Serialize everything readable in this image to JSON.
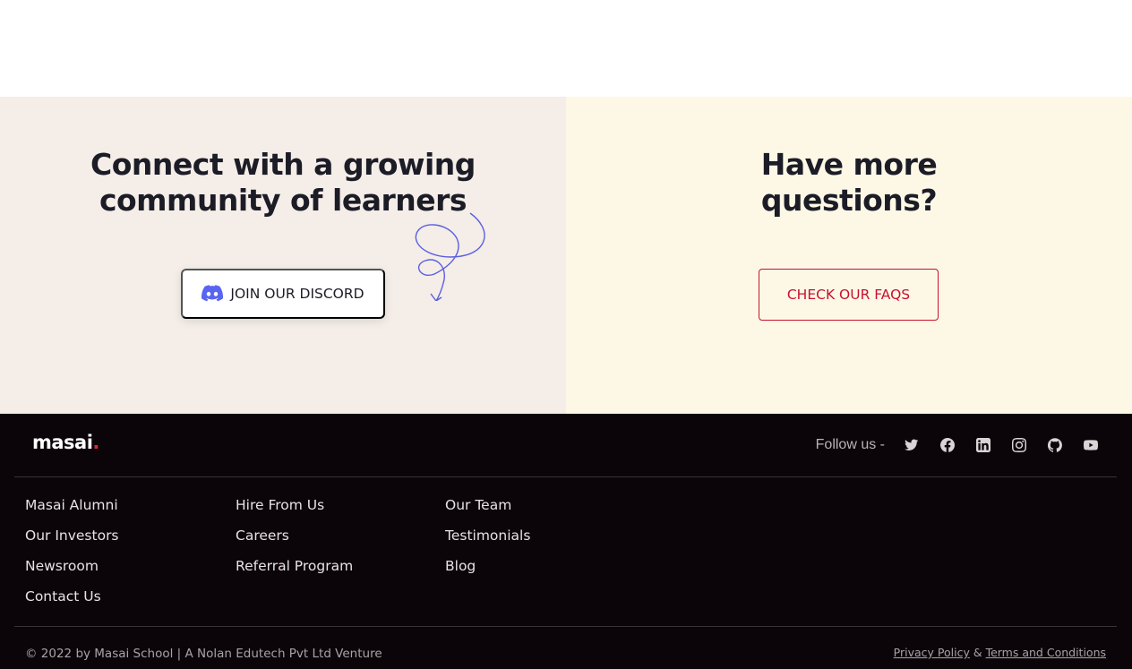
{
  "community": {
    "heading_line1": "Connect with a growing",
    "heading_line2": "community of learners",
    "discord_label": "JOIN OUR DISCORD"
  },
  "faq": {
    "heading_line1": "Have more",
    "heading_line2": "questions?",
    "button_label": "CHECK OUR FAQS"
  },
  "footer": {
    "logo_text": "masai",
    "logo_dot": ".",
    "follow_label": "Follow us -",
    "social_icons": [
      "twitter-icon",
      "facebook-icon",
      "linkedin-icon",
      "instagram-icon",
      "github-icon",
      "youtube-icon"
    ],
    "columns": [
      [
        "Masai Alumni",
        "Our Investors",
        "Newsroom",
        "Contact Us"
      ],
      [
        "Hire From Us",
        "Careers",
        "Referral Program"
      ],
      [
        "Our Team",
        "Testimonials",
        "Blog"
      ]
    ],
    "copyright": "© 2022 by Masai School | A Nolan Edutech Pvt Ltd Venture",
    "privacy_label": "Privacy Policy",
    "and_label": "&",
    "terms_label": "Terms and Conditions"
  },
  "colors": {
    "left_bg": "#f4ede8",
    "right_bg": "#fdf8e6",
    "footer_bg": "#0b0408",
    "accent_red": "#c8102e",
    "discord_purple": "#5865f2"
  }
}
